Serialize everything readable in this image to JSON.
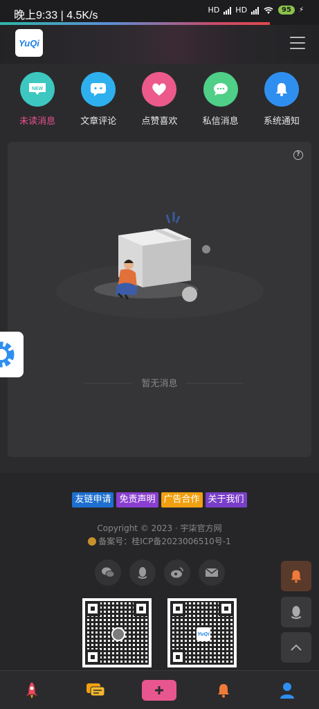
{
  "status_bar": {
    "time": "晚上9:33 | 4.5K/s",
    "network": "HD",
    "battery": "95"
  },
  "header": {
    "logo_text": "YuQi"
  },
  "nav": {
    "items": [
      {
        "label": "未读消息",
        "icon": "new-badge-icon",
        "color": "#3cc8c0",
        "badge_text": "NEW"
      },
      {
        "label": "文章评论",
        "icon": "comment-icon",
        "color": "#2fb0ee"
      },
      {
        "label": "点赞喜欢",
        "icon": "heart-icon",
        "color": "#ec5a8b"
      },
      {
        "label": "私信消息",
        "icon": "chat-bubble-icon",
        "color": "#4fcf87"
      },
      {
        "label": "系统通知",
        "icon": "bell-icon",
        "color": "#2f8ff0"
      }
    ]
  },
  "main": {
    "empty_text": "暂无消息"
  },
  "footer": {
    "links": [
      {
        "label": "友链申请",
        "color": "#1e6fd0"
      },
      {
        "label": "免责声明",
        "color": "#8a3fd0"
      },
      {
        "label": "广告合作",
        "color": "#f0a010"
      },
      {
        "label": "关于我们",
        "color": "#7a3fc8"
      }
    ],
    "copyright": "Copyright © 2023 · 宇柒官方网",
    "icp": "备案号：桂ICP备2023006510号-1",
    "qr_logo": "YuQi"
  },
  "colors": {
    "accent": "#e9508f",
    "bell_float": "#f07a3a"
  }
}
